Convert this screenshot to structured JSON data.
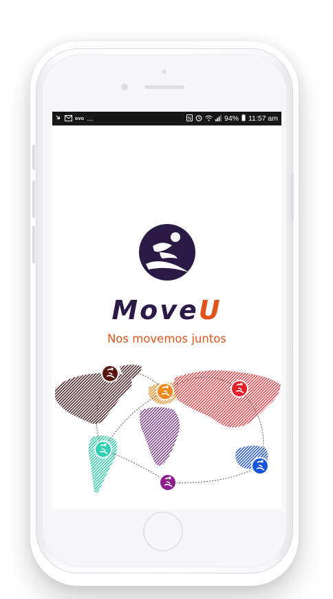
{
  "status_bar": {
    "left_icons": [
      "missed-call-icon",
      "mail-icon"
    ],
    "left_text": "ovo",
    "left_ellipsis": "...",
    "right_icons": [
      "nfc-icon",
      "alarm-icon",
      "wifi-icon",
      "signal-icon"
    ],
    "battery": "94%",
    "time": "11:57 am"
  },
  "app": {
    "brand_main": "Move",
    "brand_accent": "U",
    "tagline": "Nos movemos juntos"
  },
  "colors": {
    "brand_dark": "#2b1a45",
    "brand_orange": "#e1531d"
  },
  "map": {
    "pins": [
      {
        "name": "north-america",
        "color": "#5a1410"
      },
      {
        "name": "europe",
        "color": "#f08a1e"
      },
      {
        "name": "asia",
        "color": "#e3202a"
      },
      {
        "name": "south-america",
        "color": "#2fd1b2"
      },
      {
        "name": "africa",
        "color": "#8d1e8e"
      },
      {
        "name": "australia",
        "color": "#1756d6"
      }
    ]
  }
}
